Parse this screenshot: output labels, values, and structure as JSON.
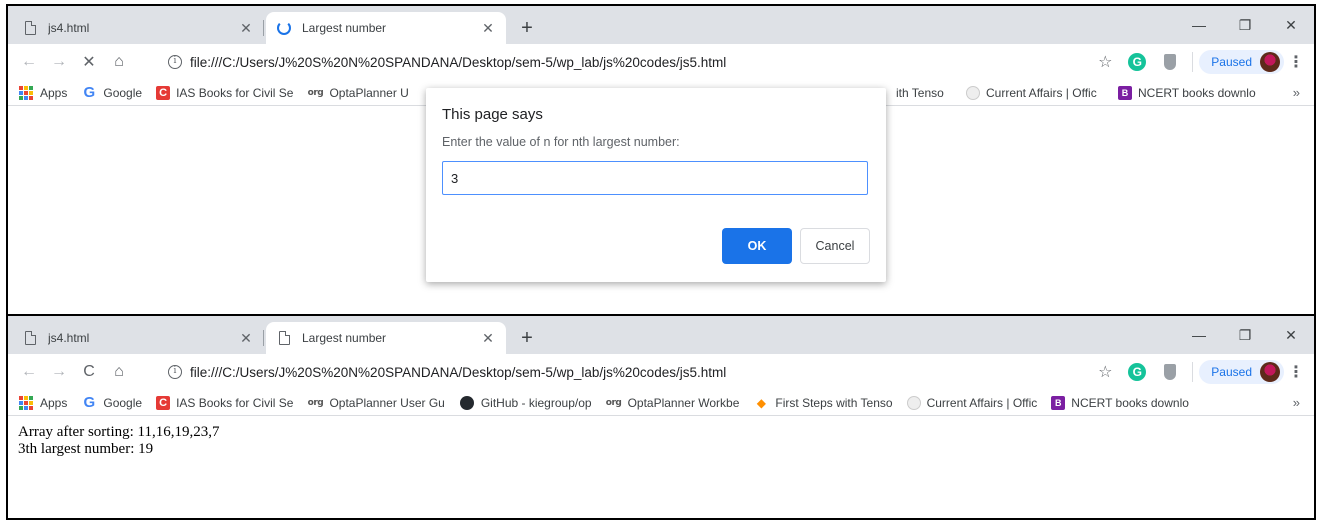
{
  "windows": [
    {
      "tabs": [
        {
          "title": "js4.html",
          "state": "inactive",
          "icon": "document-icon"
        },
        {
          "title": "Largest number",
          "state": "active",
          "icon": "loading-spinner-icon"
        }
      ],
      "nav": {
        "reload_or_stop": "stop",
        "reload_glyph": "✕"
      },
      "url": "file:///C:/Users/J%20S%20N%20SPANDANA/Desktop/sem-5/wp_lab/js%20codes/js5.html",
      "profile": {
        "status": "Paused"
      },
      "bookmarks_visible": [
        "Apps",
        "Google",
        "IAS Books for Civil Se",
        "OptaPlanner U"
      ],
      "bookmarks_right": [
        "ith Tenso",
        "Current Affairs | Offic",
        "NCERT books downlo"
      ],
      "dialog": {
        "title": "This page says",
        "message": "Enter the value of n for nth largest number:",
        "input_value": "3",
        "ok_label": "OK",
        "cancel_label": "Cancel"
      }
    },
    {
      "tabs": [
        {
          "title": "js4.html",
          "state": "inactive",
          "icon": "document-icon"
        },
        {
          "title": "Largest number",
          "state": "active",
          "icon": "document-icon"
        }
      ],
      "nav": {
        "reload_or_stop": "reload",
        "reload_glyph": "C"
      },
      "url": "file:///C:/Users/J%20S%20N%20SPANDANA/Desktop/sem-5/wp_lab/js%20codes/js5.html",
      "profile": {
        "status": "Paused"
      },
      "bookmarks": [
        "Apps",
        "Google",
        "IAS Books for Civil Se",
        "OptaPlanner User Gu",
        "GitHub - kiegroup/op",
        "OptaPlanner Workbe",
        "First Steps with Tenso",
        "Current Affairs | Offic",
        "NCERT books downlo"
      ],
      "page_lines": [
        "Array after sorting: 11,16,19,23,7",
        "3th largest number: 19"
      ]
    }
  ],
  "ui": {
    "new_tab": "+",
    "more_bookmarks": "»",
    "back": "←",
    "forward": "→",
    "home": "⌂",
    "star": "☆",
    "menu": "⋮",
    "minimize": "—",
    "restore": "❐",
    "close": "✕",
    "tab_close": "✕",
    "org_icon_text": "org"
  },
  "colors": {
    "tabstrip": "#dee1e6",
    "accent_blue": "#1a73e8",
    "grammarly_green": "#15c39a",
    "ias_red": "#e53935",
    "ncert_purple": "#7b1fa2"
  }
}
